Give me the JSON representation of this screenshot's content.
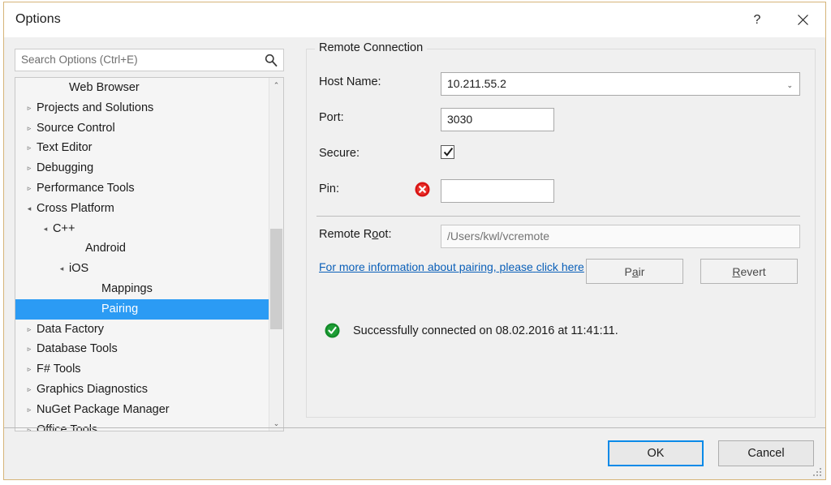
{
  "window": {
    "title": "Options",
    "help_button": "?",
    "close_button": "✕"
  },
  "search": {
    "placeholder": "Search Options (Ctrl+E)",
    "icon": "search-icon"
  },
  "tree": {
    "items": [
      {
        "label": "Web Browser",
        "indent": 3,
        "arrow": "",
        "selected": false
      },
      {
        "label": "Projects and Solutions",
        "indent": 1,
        "arrow": "▹",
        "selected": false
      },
      {
        "label": "Source Control",
        "indent": 1,
        "arrow": "▹",
        "selected": false
      },
      {
        "label": "Text Editor",
        "indent": 1,
        "arrow": "▹",
        "selected": false
      },
      {
        "label": "Debugging",
        "indent": 1,
        "arrow": "▹",
        "selected": false
      },
      {
        "label": "Performance Tools",
        "indent": 1,
        "arrow": "▹",
        "selected": false
      },
      {
        "label": "Cross Platform",
        "indent": 1,
        "arrow": "◂",
        "selected": false
      },
      {
        "label": "C++",
        "indent": 2,
        "arrow": "◂",
        "selected": false
      },
      {
        "label": "Android",
        "indent": 4,
        "arrow": "",
        "selected": false
      },
      {
        "label": "iOS",
        "indent": 3,
        "arrow": "◂",
        "selected": false
      },
      {
        "label": "Mappings",
        "indent": 5,
        "arrow": "",
        "selected": false
      },
      {
        "label": "Pairing",
        "indent": 5,
        "arrow": "",
        "selected": true
      },
      {
        "label": "Data Factory",
        "indent": 1,
        "arrow": "▹",
        "selected": false
      },
      {
        "label": "Database Tools",
        "indent": 1,
        "arrow": "▹",
        "selected": false
      },
      {
        "label": "F# Tools",
        "indent": 1,
        "arrow": "▹",
        "selected": false
      },
      {
        "label": "Graphics Diagnostics",
        "indent": 1,
        "arrow": "▹",
        "selected": false
      },
      {
        "label": "NuGet Package Manager",
        "indent": 1,
        "arrow": "▹",
        "selected": false
      },
      {
        "label": "Office Tools",
        "indent": 1,
        "arrow": "▹",
        "selected": false
      }
    ],
    "selection_color": "#2b9bf4",
    "scrollbar": {
      "up_arrow": "⌃",
      "down_arrow": "⌄"
    }
  },
  "remote_connection": {
    "group_title": "Remote Connection",
    "host_name": {
      "label": "Host Name:",
      "value": "10.211.55.2",
      "chevron": "⌄"
    },
    "port": {
      "label": "Port:",
      "value": "3030"
    },
    "secure": {
      "label": "Secure:",
      "checked": true
    },
    "pin": {
      "label": "Pin:",
      "value": "",
      "error_icon": "error-icon"
    },
    "remote_root": {
      "label": "Remote R",
      "label_accel": "o",
      "label_tail": "ot:",
      "value": "/Users/kwl/vcremote"
    },
    "info_link": {
      "line1": "For more information about pairing, please",
      "line2": "click here"
    },
    "pair_button": {
      "pre": "P",
      "accel": "a",
      "post": "ir"
    },
    "revert_button": {
      "accel": "R",
      "post": "evert"
    },
    "status": {
      "icon": "success-icon",
      "text": "Successfully connected on 08.02.2016 at 11:41:11."
    }
  },
  "footer": {
    "ok_label": "OK",
    "cancel_label": "Cancel",
    "default_button_color": "#0a8ae8"
  }
}
